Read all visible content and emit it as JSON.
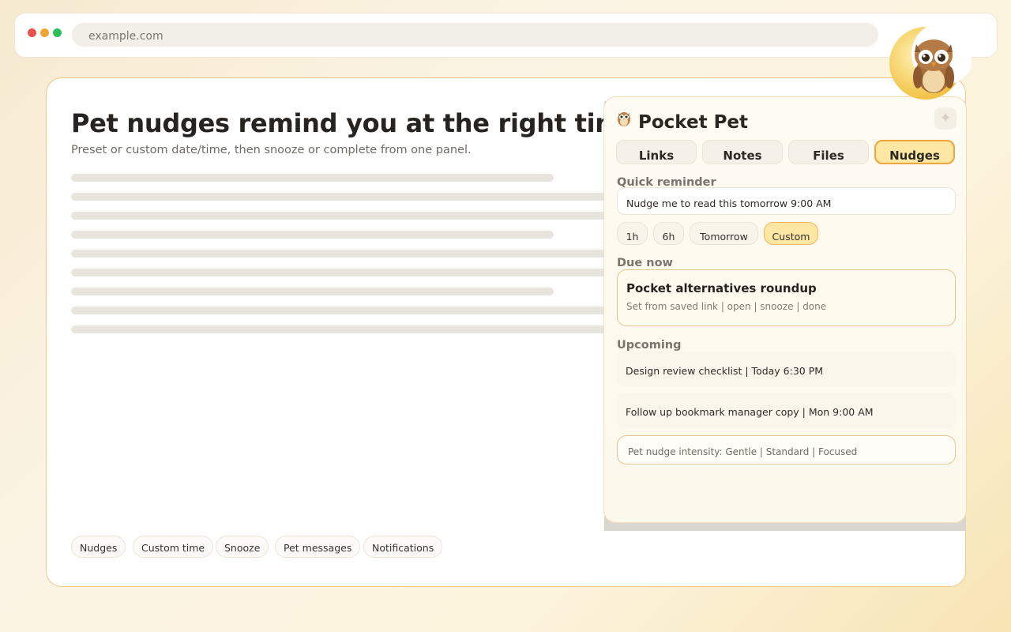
{
  "browser": {
    "url": "example.com"
  },
  "page": {
    "headline": "Pet nudges remind you at the right time",
    "subhead": "Preset or custom date/time, then snooze or complete from one panel.",
    "tags": [
      "Nudges",
      "Custom time",
      "Snooze",
      "Pet messages",
      "Notifications"
    ]
  },
  "panel": {
    "title": "Pocket Pet",
    "tabs": [
      {
        "label": "Links",
        "active": false
      },
      {
        "label": "Notes",
        "active": false
      },
      {
        "label": "Files",
        "active": false
      },
      {
        "label": "Nudges",
        "active": true
      }
    ],
    "quick_reminder": {
      "label": "Quick reminder",
      "value": "Nudge me to read this tomorrow 9:00 AM",
      "presets": [
        {
          "label": "1h",
          "active": false
        },
        {
          "label": "6h",
          "active": false
        },
        {
          "label": "Tomorrow",
          "active": false
        },
        {
          "label": "Custom",
          "active": true
        }
      ]
    },
    "due_now": {
      "label": "Due now",
      "title": "Pocket alternatives roundup",
      "meta": "Set from saved link | open | snooze | done"
    },
    "upcoming": {
      "label": "Upcoming",
      "items": [
        "Design review checklist | Today 6:30 PM",
        "Follow up bookmark manager copy | Mon 9:00 AM"
      ]
    },
    "intensity": "Pet nudge intensity: Gentle | Standard | Focused"
  },
  "colors": {
    "accent": "#f0a53e",
    "accent_fill": "#fde7a3",
    "card_border": "#f0c98a"
  },
  "icons": {
    "mascot": "owl-moon-icon",
    "logo": "owl-icon",
    "settings": "gear-icon"
  }
}
